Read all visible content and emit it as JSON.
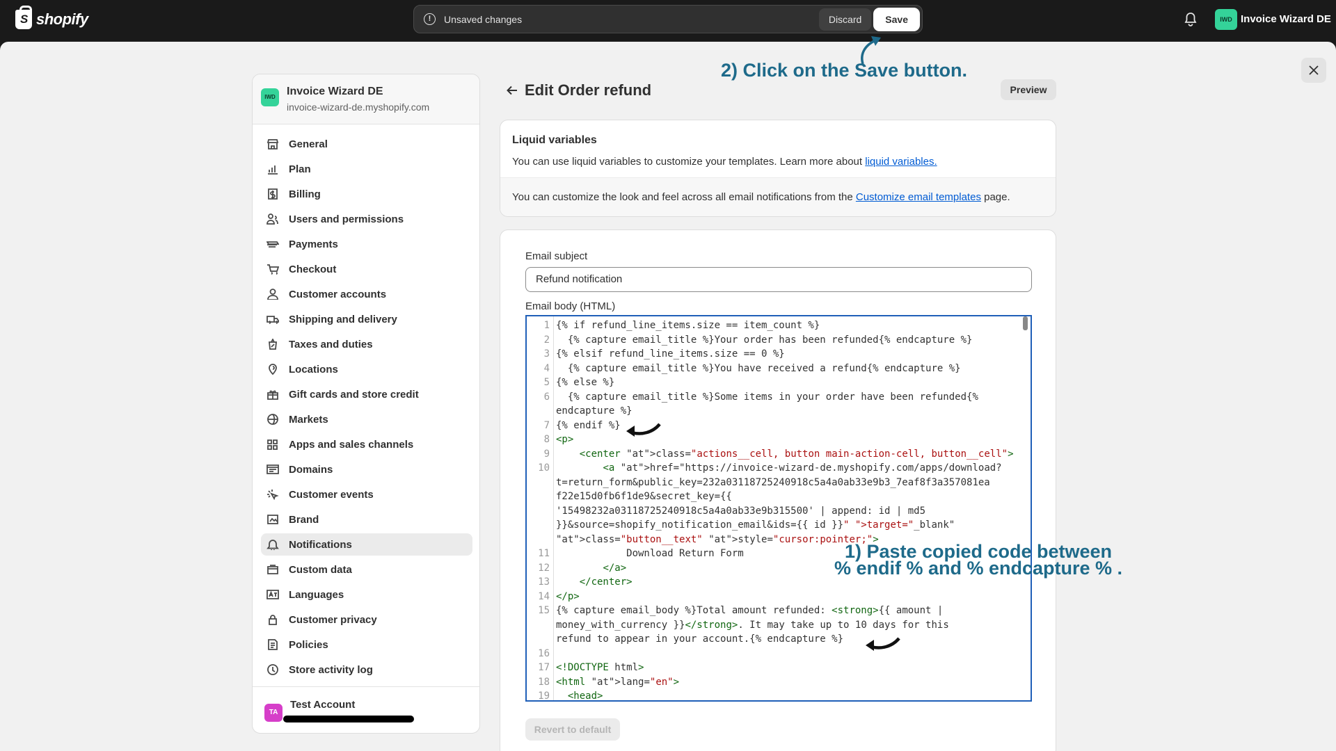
{
  "topbar": {
    "brand": "shopify",
    "unsaved_text": "Unsaved changes",
    "discard_label": "Discard",
    "save_label": "Save",
    "store_badge": "IWD",
    "store_name": "Invoice Wizard DE"
  },
  "sidebar": {
    "store_badge": "IWD",
    "store_name": "Invoice Wizard DE",
    "store_domain": "invoice-wizard-de.myshopify.com",
    "items": [
      {
        "label": "General",
        "icon": "store-icon"
      },
      {
        "label": "Plan",
        "icon": "chart-icon"
      },
      {
        "label": "Billing",
        "icon": "dollar-icon"
      },
      {
        "label": "Users and permissions",
        "icon": "users-icon"
      },
      {
        "label": "Payments",
        "icon": "payments-icon"
      },
      {
        "label": "Checkout",
        "icon": "cart-icon"
      },
      {
        "label": "Customer accounts",
        "icon": "person-icon"
      },
      {
        "label": "Shipping and delivery",
        "icon": "truck-icon"
      },
      {
        "label": "Taxes and duties",
        "icon": "tax-icon"
      },
      {
        "label": "Locations",
        "icon": "location-icon"
      },
      {
        "label": "Gift cards and store credit",
        "icon": "gift-icon"
      },
      {
        "label": "Markets",
        "icon": "globe-icon"
      },
      {
        "label": "Apps and sales channels",
        "icon": "apps-icon"
      },
      {
        "label": "Domains",
        "icon": "domain-icon"
      },
      {
        "label": "Customer events",
        "icon": "cursor-icon"
      },
      {
        "label": "Brand",
        "icon": "brand-icon"
      },
      {
        "label": "Notifications",
        "icon": "bell-icon"
      },
      {
        "label": "Custom data",
        "icon": "database-icon"
      },
      {
        "label": "Languages",
        "icon": "language-icon"
      },
      {
        "label": "Customer privacy",
        "icon": "lock-icon"
      },
      {
        "label": "Policies",
        "icon": "policy-icon"
      },
      {
        "label": "Store activity log",
        "icon": "activity-icon"
      }
    ],
    "active_item": "Notifications",
    "account_badge": "TA",
    "account_name": "Test Account"
  },
  "header": {
    "title": "Edit Order refund",
    "preview_label": "Preview"
  },
  "liquid_card": {
    "title": "Liquid variables",
    "text": "You can use liquid variables to customize your templates. Learn more about ",
    "link": "liquid variables.",
    "sub_text": "You can customize the look and feel across all email notifications from the ",
    "sub_link": "Customize email templates",
    "sub_tail": " page."
  },
  "form": {
    "subject_label": "Email subject",
    "subject_value": "Refund notification",
    "body_label": "Email body (HTML)",
    "revert_label": "Revert to default"
  },
  "code_lines": [
    {
      "n": "1",
      "t": "{% if refund_line_items.size == item_count %}"
    },
    {
      "n": "2",
      "t": "  {% capture email_title %}Your order has been refunded{% endcapture %}"
    },
    {
      "n": "3",
      "t": "{% elsif refund_line_items.size == 0 %}"
    },
    {
      "n": "4",
      "t": "  {% capture email_title %}You have received a refund{% endcapture %}"
    },
    {
      "n": "5",
      "t": "{% else %}"
    },
    {
      "n": "6",
      "t": "  {% capture email_title %}Some items in your order have been refunded{%"
    },
    {
      "n": "",
      "t": "endcapture %}"
    },
    {
      "n": "7",
      "t": "{% endif %}"
    },
    {
      "n": "8",
      "t": "<p>"
    },
    {
      "n": "9",
      "t": "    <center class=\"actions__cell, button main-action-cell, button__cell\">"
    },
    {
      "n": "10",
      "t": "        <a href=\"https://invoice-wizard-de.myshopify.com/apps/download?"
    },
    {
      "n": "",
      "t": "t=return_form&public_key=232a03118725240918c5a4a0ab33e9b3_7eaf8f3a357081ea"
    },
    {
      "n": "",
      "t": "f22e15d0fb6f1de9&secret_key={{"
    },
    {
      "n": "",
      "t": "'15498232a03118725240918c5a4a0ab33e9b315500' | append: id | md5"
    },
    {
      "n": "",
      "t": "}}&source=shopify_notification_email&ids={{ id }}\" target=\"_blank\""
    },
    {
      "n": "",
      "t": "class=\"button__text\" style=\"cursor:pointer;\">"
    },
    {
      "n": "11",
      "t": "            Download Return Form"
    },
    {
      "n": "12",
      "t": "        </a>"
    },
    {
      "n": "13",
      "t": "    </center>"
    },
    {
      "n": "14",
      "t": "</p>"
    },
    {
      "n": "15",
      "t": "{% capture email_body %}Total amount refunded: <strong>{{ amount |"
    },
    {
      "n": "",
      "t": "money_with_currency }}</strong>. It may take up to 10 days for this"
    },
    {
      "n": "",
      "t": "refund to appear in your account.{% endcapture %}"
    },
    {
      "n": "16",
      "t": ""
    },
    {
      "n": "17",
      "t": "<!DOCTYPE html>"
    },
    {
      "n": "18",
      "t": "<html lang=\"en\">"
    },
    {
      "n": "19",
      "t": "  <head>"
    }
  ],
  "annotations": {
    "step2": "2) Click on the Save button.",
    "step1_line1": "1) Paste copied code between",
    "step1_line2": "% endif % and % endcapture % ."
  },
  "colors": {
    "accent_link": "#005bd3",
    "annotation": "#1e6a8a",
    "editor_border": "#1f5fb8",
    "iwd_badge": "#34d399",
    "ta_badge": "#d63ec9"
  }
}
